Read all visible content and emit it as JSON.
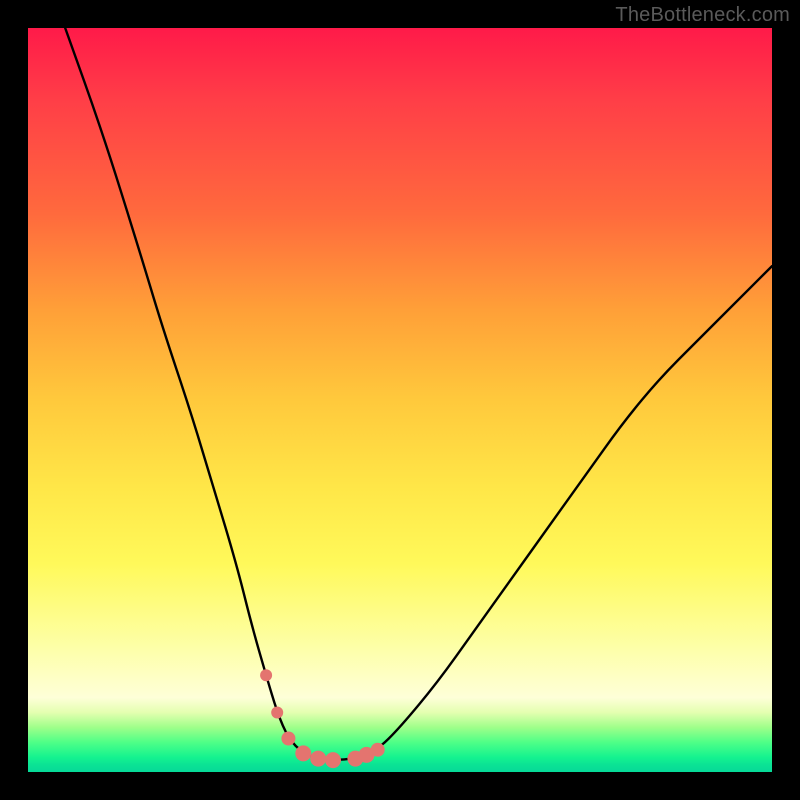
{
  "watermark": "TheBottleneck.com",
  "colors": {
    "background": "#000000",
    "curve_stroke": "#000000",
    "marker_fill": "#e4746f",
    "gradient_stops": [
      "#ff1a49",
      "#ff6a3d",
      "#ffc93c",
      "#fff95a",
      "#feffd8",
      "#4fff87",
      "#06d998"
    ]
  },
  "chart_data": {
    "type": "line",
    "title": "",
    "xlabel": "",
    "ylabel": "",
    "xlim": [
      0,
      100
    ],
    "ylim": [
      0,
      100
    ],
    "note": "No axis ticks or numeric labels are rendered; values are pixel-estimated against a 0–100 relative scale on each axis, where y=100 is the top edge and y=0 is the bottom edge of the gradient plot area.",
    "series": [
      {
        "name": "bottleneck-curve",
        "x": [
          5,
          10,
          15,
          18,
          22,
          25,
          28,
          30,
          32,
          33.5,
          35,
          37,
          39,
          41,
          44,
          47,
          50,
          55,
          60,
          65,
          70,
          75,
          80,
          85,
          90,
          95,
          100
        ],
        "y": [
          100,
          86,
          70,
          60,
          48,
          38,
          28,
          20,
          13,
          8,
          4.5,
          2.5,
          1.8,
          1.6,
          1.8,
          3,
          6,
          12,
          19,
          26,
          33,
          40,
          47,
          53,
          58,
          63,
          68
        ]
      }
    ],
    "markers": {
      "name": "highlight-dots",
      "note": "Salmon-colored dotted segment highlighting the trough region of the curve.",
      "x": [
        32,
        33.5,
        35,
        37,
        39,
        41,
        44,
        45.5,
        47
      ],
      "y": [
        13,
        8,
        4.5,
        2.5,
        1.8,
        1.6,
        1.8,
        2.3,
        3
      ],
      "r": [
        6,
        6,
        7,
        8,
        8,
        8,
        8,
        8,
        7
      ]
    }
  }
}
